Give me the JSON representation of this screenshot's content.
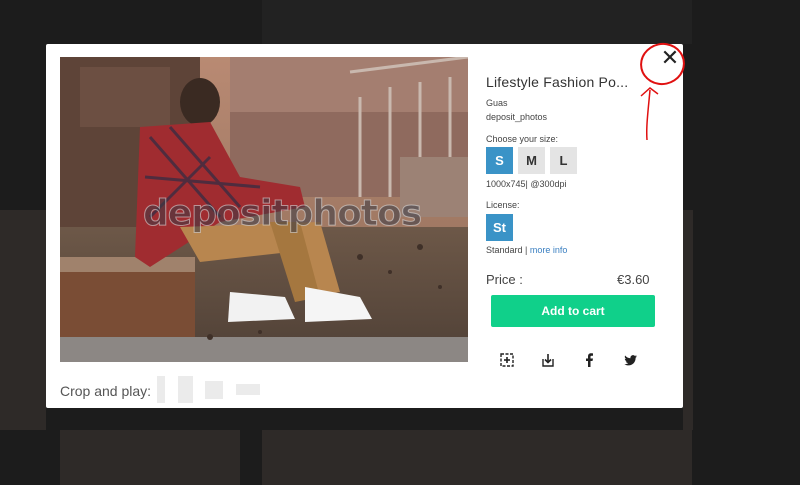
{
  "modal": {
    "title": "Lifestyle Fashion Po...",
    "author": "Guas",
    "site": "deposit_photos",
    "choose_size_label": "Choose your size:",
    "sizes": [
      "S",
      "M",
      "L"
    ],
    "selected_size": "S",
    "dimensions": "1000x745| @300dpi",
    "license_label": "License:",
    "license_badge": "St",
    "license_type": "Standard",
    "license_separator": " | ",
    "more_info_link": "more info",
    "price_label": "Price :",
    "price_value": "€3.60",
    "cart_button": "Add to cart",
    "close_glyph": "✕",
    "crop_label": "Crop and play:",
    "watermark": "depositphotos",
    "action_icons": [
      "add-to-lightbox-icon",
      "download-icon",
      "facebook-icon",
      "twitter-icon"
    ]
  },
  "colors": {
    "accent_blue": "#3a93c7",
    "cart_green": "#10d08a",
    "annotation_red": "#e01010"
  }
}
